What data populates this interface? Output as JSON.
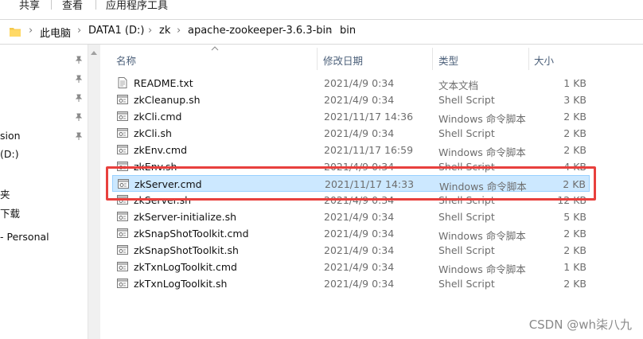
{
  "ribbon": {
    "tabs": [
      "共享",
      "查看",
      "应用程序工具"
    ]
  },
  "address": {
    "crumbs": [
      "此电脑",
      "DATA1 (D:)",
      "zk",
      "apache-zookeeper-3.6.3-bin",
      "bin"
    ]
  },
  "nav": {
    "items": [
      "sion",
      "(D:)",
      "夹",
      "下载",
      "- Personal"
    ]
  },
  "columns": {
    "name": "名称",
    "date": "修改日期",
    "type": "类型",
    "size": "大小"
  },
  "files": [
    {
      "name": "README.txt",
      "date": "2021/4/9 0:34",
      "type": "文本文档",
      "size": "1 KB",
      "icon": "text-file-icon"
    },
    {
      "name": "zkCleanup.sh",
      "date": "2021/4/9 0:34",
      "type": "Shell Script",
      "size": "3 KB",
      "icon": "script-file-icon"
    },
    {
      "name": "zkCli.cmd",
      "date": "2021/11/17 14:36",
      "type": "Windows 命令脚本",
      "size": "2 KB",
      "icon": "cmd-file-icon"
    },
    {
      "name": "zkCli.sh",
      "date": "2021/4/9 0:34",
      "type": "Shell Script",
      "size": "2 KB",
      "icon": "script-file-icon"
    },
    {
      "name": "zkEnv.cmd",
      "date": "2021/11/17 16:59",
      "type": "Windows 命令脚本",
      "size": "2 KB",
      "icon": "cmd-file-icon"
    },
    {
      "name": "zkEnv.sh",
      "date": "2021/4/9 0:34",
      "type": "Shell Script",
      "size": "4 KB",
      "icon": "script-file-icon"
    },
    {
      "name": "zkServer.cmd",
      "date": "2021/11/17 14:33",
      "type": "Windows 命令脚本",
      "size": "2 KB",
      "icon": "cmd-file-icon",
      "selected": true
    },
    {
      "name": "zkServer.sh",
      "date": "2021/4/9 0:34",
      "type": "Shell Script",
      "size": "12 KB",
      "icon": "script-file-icon"
    },
    {
      "name": "zkServer-initialize.sh",
      "date": "2021/4/9 0:34",
      "type": "Shell Script",
      "size": "5 KB",
      "icon": "script-file-icon"
    },
    {
      "name": "zkSnapShotToolkit.cmd",
      "date": "2021/4/9 0:34",
      "type": "Windows 命令脚本",
      "size": "2 KB",
      "icon": "cmd-file-icon"
    },
    {
      "name": "zkSnapShotToolkit.sh",
      "date": "2021/4/9 0:34",
      "type": "Shell Script",
      "size": "2 KB",
      "icon": "script-file-icon"
    },
    {
      "name": "zkTxnLogToolkit.cmd",
      "date": "2021/4/9 0:34",
      "type": "Windows 命令脚本",
      "size": "1 KB",
      "icon": "cmd-file-icon"
    },
    {
      "name": "zkTxnLogToolkit.sh",
      "date": "2021/4/9 0:34",
      "type": "Shell Script",
      "size": "2 KB",
      "icon": "script-file-icon"
    }
  ],
  "watermark": "CSDN @wh柒八九",
  "colors": {
    "selection": "#cce8ff",
    "highlight_box": "#e8403d",
    "header_text": "#4c607a"
  }
}
